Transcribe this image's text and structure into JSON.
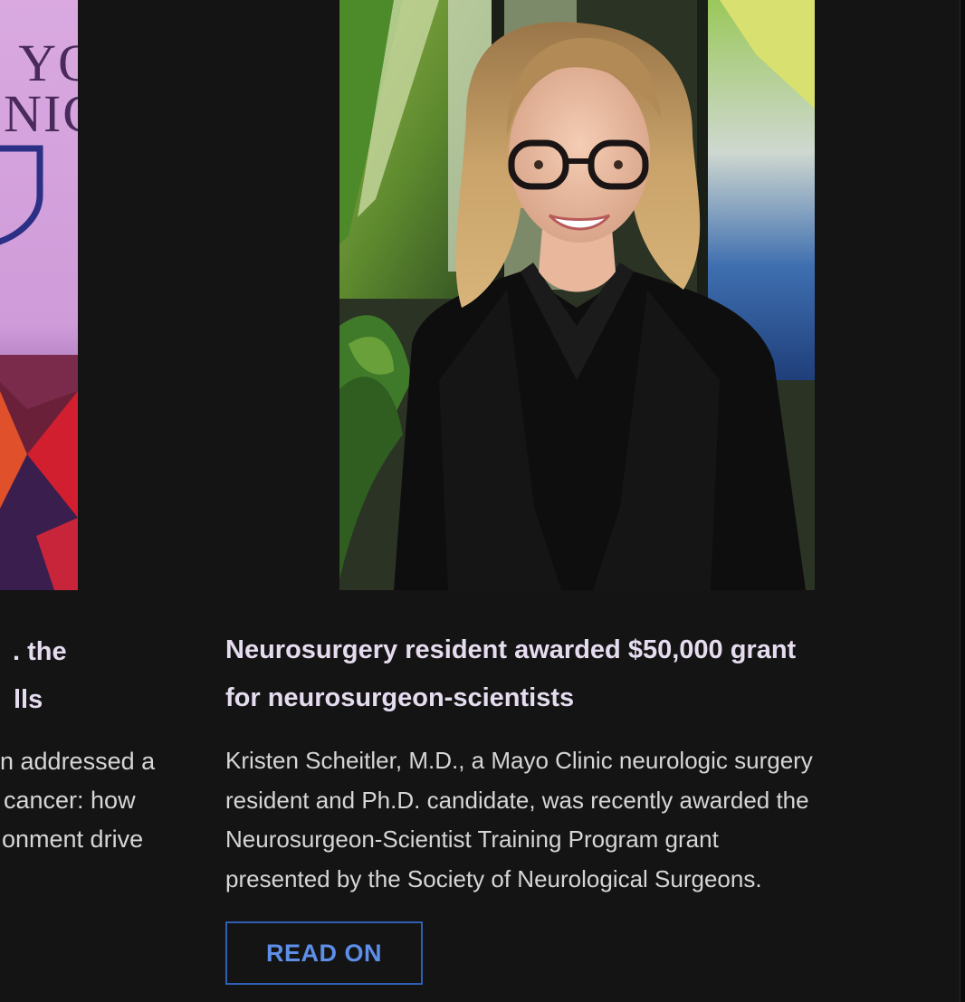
{
  "left_card": {
    "thumbnail": {
      "logo_lines": [
        "YO",
        "NIC"
      ],
      "icon": "shield-icon",
      "colors": {
        "background": "#d9a9e0",
        "logo_text": "#4a2a5a"
      }
    },
    "title_lines": [
      ". the",
      "lls"
    ],
    "body_lines": [
      "n addressed a",
      "cancer: how",
      "onment drive"
    ]
  },
  "right_card": {
    "photo_description_icon": "portrait-photo",
    "title_lines": [
      "Neurosurgery resident awarded $50,000 grant",
      "for neurosurgeon-scientists"
    ],
    "body_lines": [
      "Kristen Scheitler, M.D., a Mayo Clinic neurologic surgery",
      "resident and Ph.D. candidate, was recently awarded the",
      "Neurosurgeon-Scientist Training Program grant",
      "presented by the Society of Neurological Surgeons."
    ],
    "cta_label": "READ ON"
  },
  "colors": {
    "background": "#141414",
    "title": "#e6dcef",
    "body": "#d6d6d6",
    "accent": "#5d8ee8",
    "accent_border": "#2f5fb5"
  }
}
